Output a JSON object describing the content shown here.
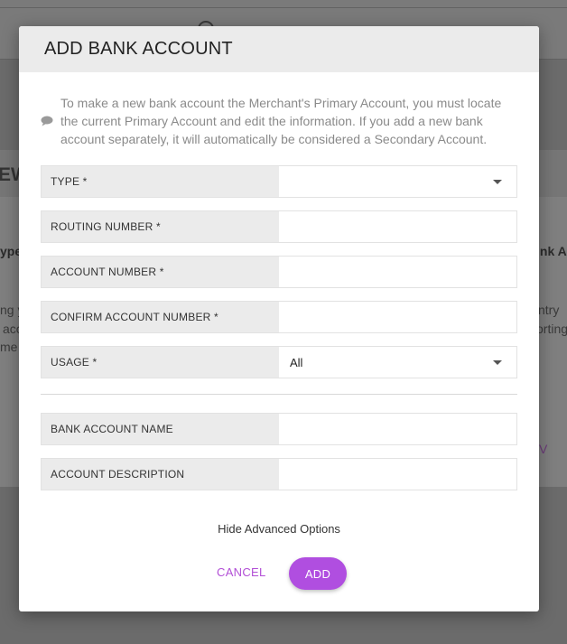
{
  "background": {
    "left_title_fragment": "EW",
    "left_label_fragment": "ype",
    "left_body_lines": [
      "ng y",
      "acc",
      "me"
    ],
    "right_label_fragment": "ink A",
    "right_body_lines": [
      "ntry",
      "orting"
    ],
    "right_link_fragment": "V"
  },
  "modal": {
    "title": "ADD BANK ACCOUNT",
    "info_text": "To make a new bank account the Merchant's Primary Account, you must locate the current Primary Account and edit the information. If you add a new bank account separately, it will automatically be considered a Secondary Account.",
    "info_icon": "comment-icon",
    "fields": {
      "type": {
        "label": "TYPE *",
        "value": ""
      },
      "routing": {
        "label": "ROUTING NUMBER *",
        "value": ""
      },
      "account": {
        "label": "ACCOUNT NUMBER *",
        "value": ""
      },
      "confirm": {
        "label": "CONFIRM ACCOUNT NUMBER *",
        "value": ""
      },
      "usage": {
        "label": "USAGE *",
        "value": "All"
      },
      "bank_name": {
        "label": "BANK ACCOUNT NAME",
        "value": ""
      },
      "description": {
        "label": "ACCOUNT DESCRIPTION",
        "value": ""
      }
    },
    "advanced_toggle": "Hide Advanced Options",
    "cancel_label": "CANCEL",
    "add_label": "ADD"
  },
  "colors": {
    "accent": "#b04ee0",
    "accent_text": "#b24fd6",
    "label_bg": "#ebebeb",
    "overlay": "#6b6b6b"
  }
}
